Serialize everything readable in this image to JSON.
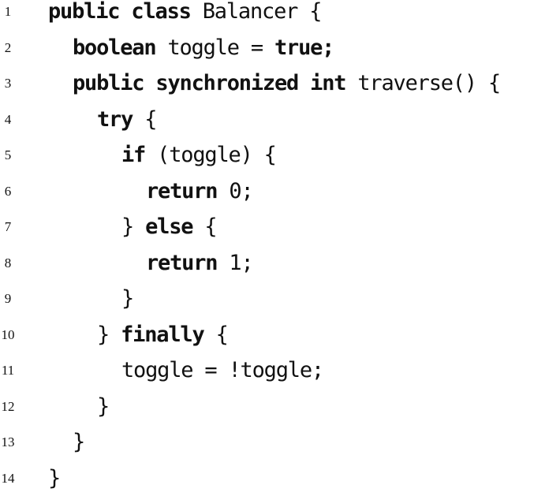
{
  "lines": [
    {
      "number": "1",
      "indent": 0,
      "tokens": [
        {
          "text": "public",
          "kind": "keyword"
        },
        {
          "text": " ",
          "kind": "plain"
        },
        {
          "text": "class",
          "kind": "keyword"
        },
        {
          "text": " Balancer {",
          "kind": "plain"
        }
      ]
    },
    {
      "number": "2",
      "indent": 1,
      "tokens": [
        {
          "text": "boolean",
          "kind": "keyword"
        },
        {
          "text": " toggle = ",
          "kind": "plain"
        },
        {
          "text": "true;",
          "kind": "keyword"
        }
      ]
    },
    {
      "number": "3",
      "indent": 1,
      "tokens": [
        {
          "text": "public",
          "kind": "keyword"
        },
        {
          "text": " ",
          "kind": "plain"
        },
        {
          "text": "synchronized",
          "kind": "keyword"
        },
        {
          "text": " ",
          "kind": "plain"
        },
        {
          "text": "int",
          "kind": "keyword"
        },
        {
          "text": " traverse() {",
          "kind": "plain"
        }
      ]
    },
    {
      "number": "4",
      "indent": 2,
      "tokens": [
        {
          "text": "try",
          "kind": "keyword"
        },
        {
          "text": " {",
          "kind": "plain"
        }
      ]
    },
    {
      "number": "5",
      "indent": 3,
      "tokens": [
        {
          "text": "if",
          "kind": "keyword"
        },
        {
          "text": " (toggle) {",
          "kind": "plain"
        }
      ]
    },
    {
      "number": "6",
      "indent": 4,
      "tokens": [
        {
          "text": "return",
          "kind": "keyword"
        },
        {
          "text": " 0;",
          "kind": "plain"
        }
      ]
    },
    {
      "number": "7",
      "indent": 3,
      "tokens": [
        {
          "text": "} ",
          "kind": "plain"
        },
        {
          "text": "else",
          "kind": "keyword"
        },
        {
          "text": " {",
          "kind": "plain"
        }
      ]
    },
    {
      "number": "8",
      "indent": 4,
      "tokens": [
        {
          "text": "return",
          "kind": "keyword"
        },
        {
          "text": " 1;",
          "kind": "plain"
        }
      ]
    },
    {
      "number": "9",
      "indent": 3,
      "tokens": [
        {
          "text": "}",
          "kind": "plain"
        }
      ]
    },
    {
      "number": "10",
      "indent": 2,
      "tokens": [
        {
          "text": "} ",
          "kind": "plain"
        },
        {
          "text": "finally",
          "kind": "keyword"
        },
        {
          "text": " {",
          "kind": "plain"
        }
      ]
    },
    {
      "number": "11",
      "indent": 3,
      "tokens": [
        {
          "text": "toggle = !toggle;",
          "kind": "plain"
        }
      ]
    },
    {
      "number": "12",
      "indent": 2,
      "tokens": [
        {
          "text": "}",
          "kind": "plain"
        }
      ]
    },
    {
      "number": "13",
      "indent": 1,
      "tokens": [
        {
          "text": "}",
          "kind": "plain"
        }
      ]
    },
    {
      "number": "14",
      "indent": 0,
      "tokens": [
        {
          "text": "}",
          "kind": "plain"
        }
      ]
    }
  ]
}
